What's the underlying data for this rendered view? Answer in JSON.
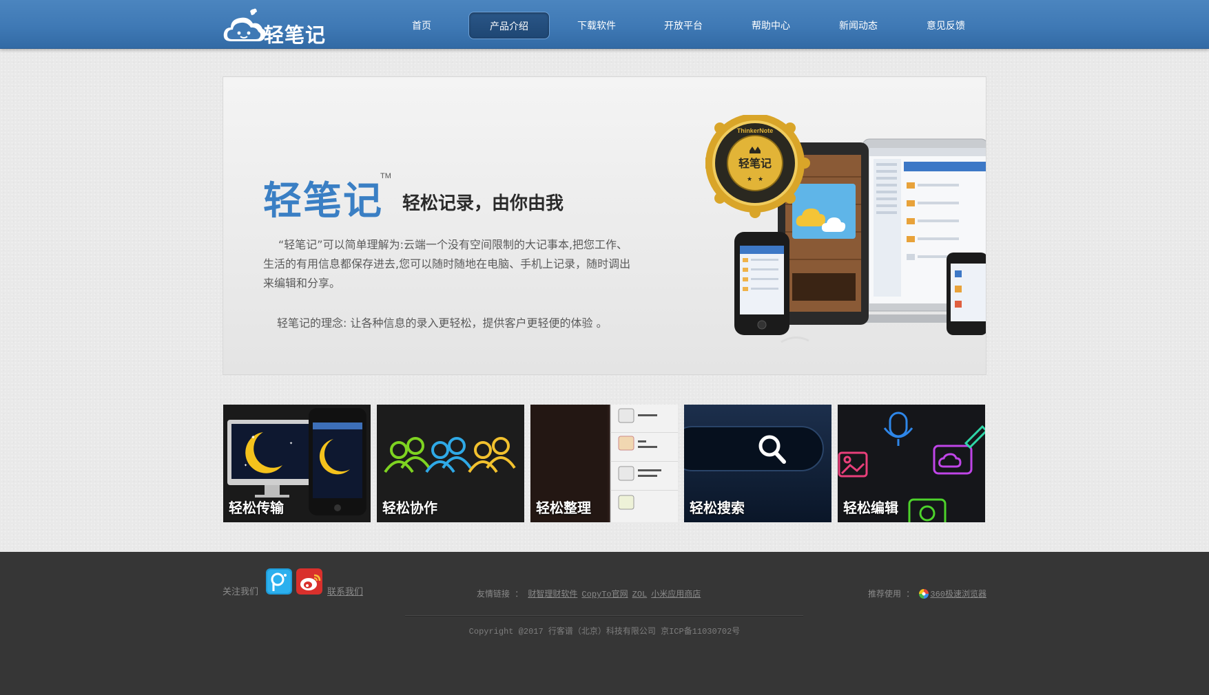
{
  "header": {
    "logo_text": "轻笔记",
    "nav": [
      {
        "label": "首页",
        "active": false
      },
      {
        "label": "产品介绍",
        "active": true
      },
      {
        "label": "下载软件",
        "active": false
      },
      {
        "label": "开放平台",
        "active": false
      },
      {
        "label": "帮助中心",
        "active": false
      },
      {
        "label": "新闻动态",
        "active": false
      },
      {
        "label": "意见反馈",
        "active": false
      }
    ]
  },
  "banner": {
    "title": "轻笔记",
    "tm": "TM",
    "slogan": "轻松记录，由你由我",
    "description": "“轻笔记”可以简单理解为:云端一个没有空间限制的大记事本,把您工作、生活的有用信息都保存进去,您可以随时随地在电脑、手机上记录，随时调出来编辑和分享。",
    "philosophy": "轻笔记的理念: 让各种信息的录入更轻松，提供客户更轻便的体验 。",
    "seal_text": "轻笔记",
    "seal_ring": "ThinkerNote"
  },
  "features": [
    {
      "label": "轻松传输",
      "icon": "moon-devices-icon"
    },
    {
      "label": "轻松协作",
      "icon": "people-group-icon"
    },
    {
      "label": "轻松整理",
      "icon": "note-list-icon"
    },
    {
      "label": "轻松搜索",
      "icon": "magnifier-icon"
    },
    {
      "label": "轻松编辑",
      "icon": "media-edit-icon"
    }
  ],
  "footer": {
    "follow_label": "关注我们",
    "contact_label": "联系我们",
    "links_label": "友情链接 ：",
    "links": [
      "财智理财软件",
      "CopyTo官网",
      "ZOL",
      "小米应用商店"
    ],
    "recommend_label": "推荐使用 ：",
    "recommend_link": "360极速浏览器",
    "copyright": "Copyright @2017 行客谱（北京）科技有限公司 京ICP备11030702号"
  },
  "colors": {
    "header_blue": "#3f79b5",
    "brand_blue": "#3a7fc4",
    "footer_bg": "#363636"
  }
}
